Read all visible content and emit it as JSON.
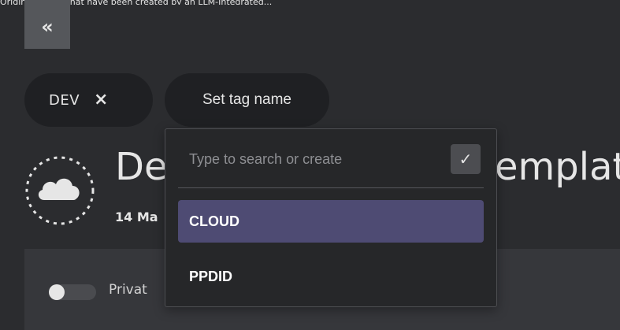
{
  "caption_text": "Original Image that have been created by an LLM-Integrated...",
  "sidebar": {
    "collapse_label": "«"
  },
  "tags": {
    "applied": [
      {
        "label": "DEV",
        "remove_icon": "×"
      }
    ],
    "set_tag_label": "Set tag name"
  },
  "header": {
    "logo_icon": "cloud-icon",
    "title_left": "De",
    "title_right": "emplat",
    "subtitle": "14 Ma"
  },
  "settings": {
    "private_label": "Privat"
  },
  "tag_dropdown": {
    "search_placeholder": "Type to search or create",
    "search_value": "",
    "confirm_icon": "✓",
    "options": [
      {
        "label": "CLOUD",
        "selected": true
      },
      {
        "label": "PPDID",
        "selected": false
      }
    ]
  },
  "colors": {
    "background": "#2b2c2f",
    "chip": "#1f2023",
    "dropdown": "#262729",
    "selected_option": "#4e4b73",
    "text": "#e6e6e6"
  }
}
